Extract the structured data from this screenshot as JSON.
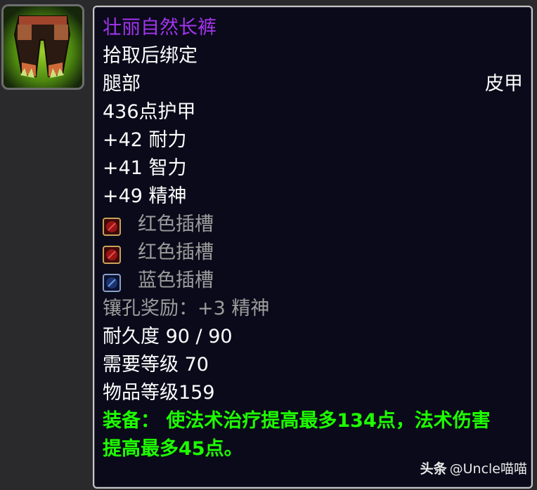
{
  "item": {
    "name": "壮丽自然长裤",
    "binding": "拾取后绑定",
    "slot": "腿部",
    "armor_type": "皮甲",
    "armor": "436点护甲",
    "stats": [
      "+42 耐力",
      "+41 智力",
      "+49 精神"
    ],
    "sockets": [
      {
        "color": "red",
        "label": "红色插槽"
      },
      {
        "color": "red",
        "label": "红色插槽"
      },
      {
        "color": "blue",
        "label": "蓝色插槽"
      }
    ],
    "socket_bonus": "镶孔奖励：+3 精神",
    "durability": "耐久度 90 / 90",
    "required_level": "需要等级 70",
    "item_level": "物品等级159",
    "equip_line1": "装备：  使法术治疗提高最多134点，法术伤害",
    "equip_line2": "提高最多45点。",
    "icon": "leather-pants-icon"
  },
  "watermark": {
    "main": "头条",
    "handle": "@Uncle喵喵"
  },
  "colors": {
    "epic": "#a335ee",
    "green": "#1eff00",
    "gray": "#9d9d9d"
  }
}
